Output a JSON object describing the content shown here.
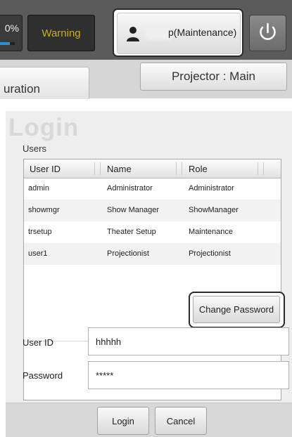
{
  "topbar": {
    "progress_text": "0%",
    "progress_fraction": 0.7,
    "warning_label": "Warning",
    "user_label": "p(Maintenance)",
    "accent_color": "#2f8fd8",
    "warning_color": "#c9b020"
  },
  "tabs": {
    "left_tab_label": "uration",
    "projector_label": "Projector : Main"
  },
  "login": {
    "title": "Login",
    "users_label": "Users",
    "columns": [
      "User ID",
      "Name",
      "Role"
    ],
    "rows": [
      {
        "user_id": "admin",
        "name": "Administrator",
        "role": "Administrator"
      },
      {
        "user_id": "showmgr",
        "name": "Show Manager",
        "role": "ShowManager"
      },
      {
        "user_id": "trsetup",
        "name": "Theater Setup",
        "role": "Maintenance"
      },
      {
        "user_id": "user1",
        "name": "Projectionist",
        "role": "Projectionist"
      }
    ],
    "change_password_label": "Change Password",
    "user_id_label": "User ID",
    "user_id_value": "hhhhh",
    "password_label": "Password",
    "password_value": "*****",
    "login_button": "Login",
    "cancel_button": "Cancel"
  },
  "icons": [
    "user-icon",
    "power-icon"
  ]
}
